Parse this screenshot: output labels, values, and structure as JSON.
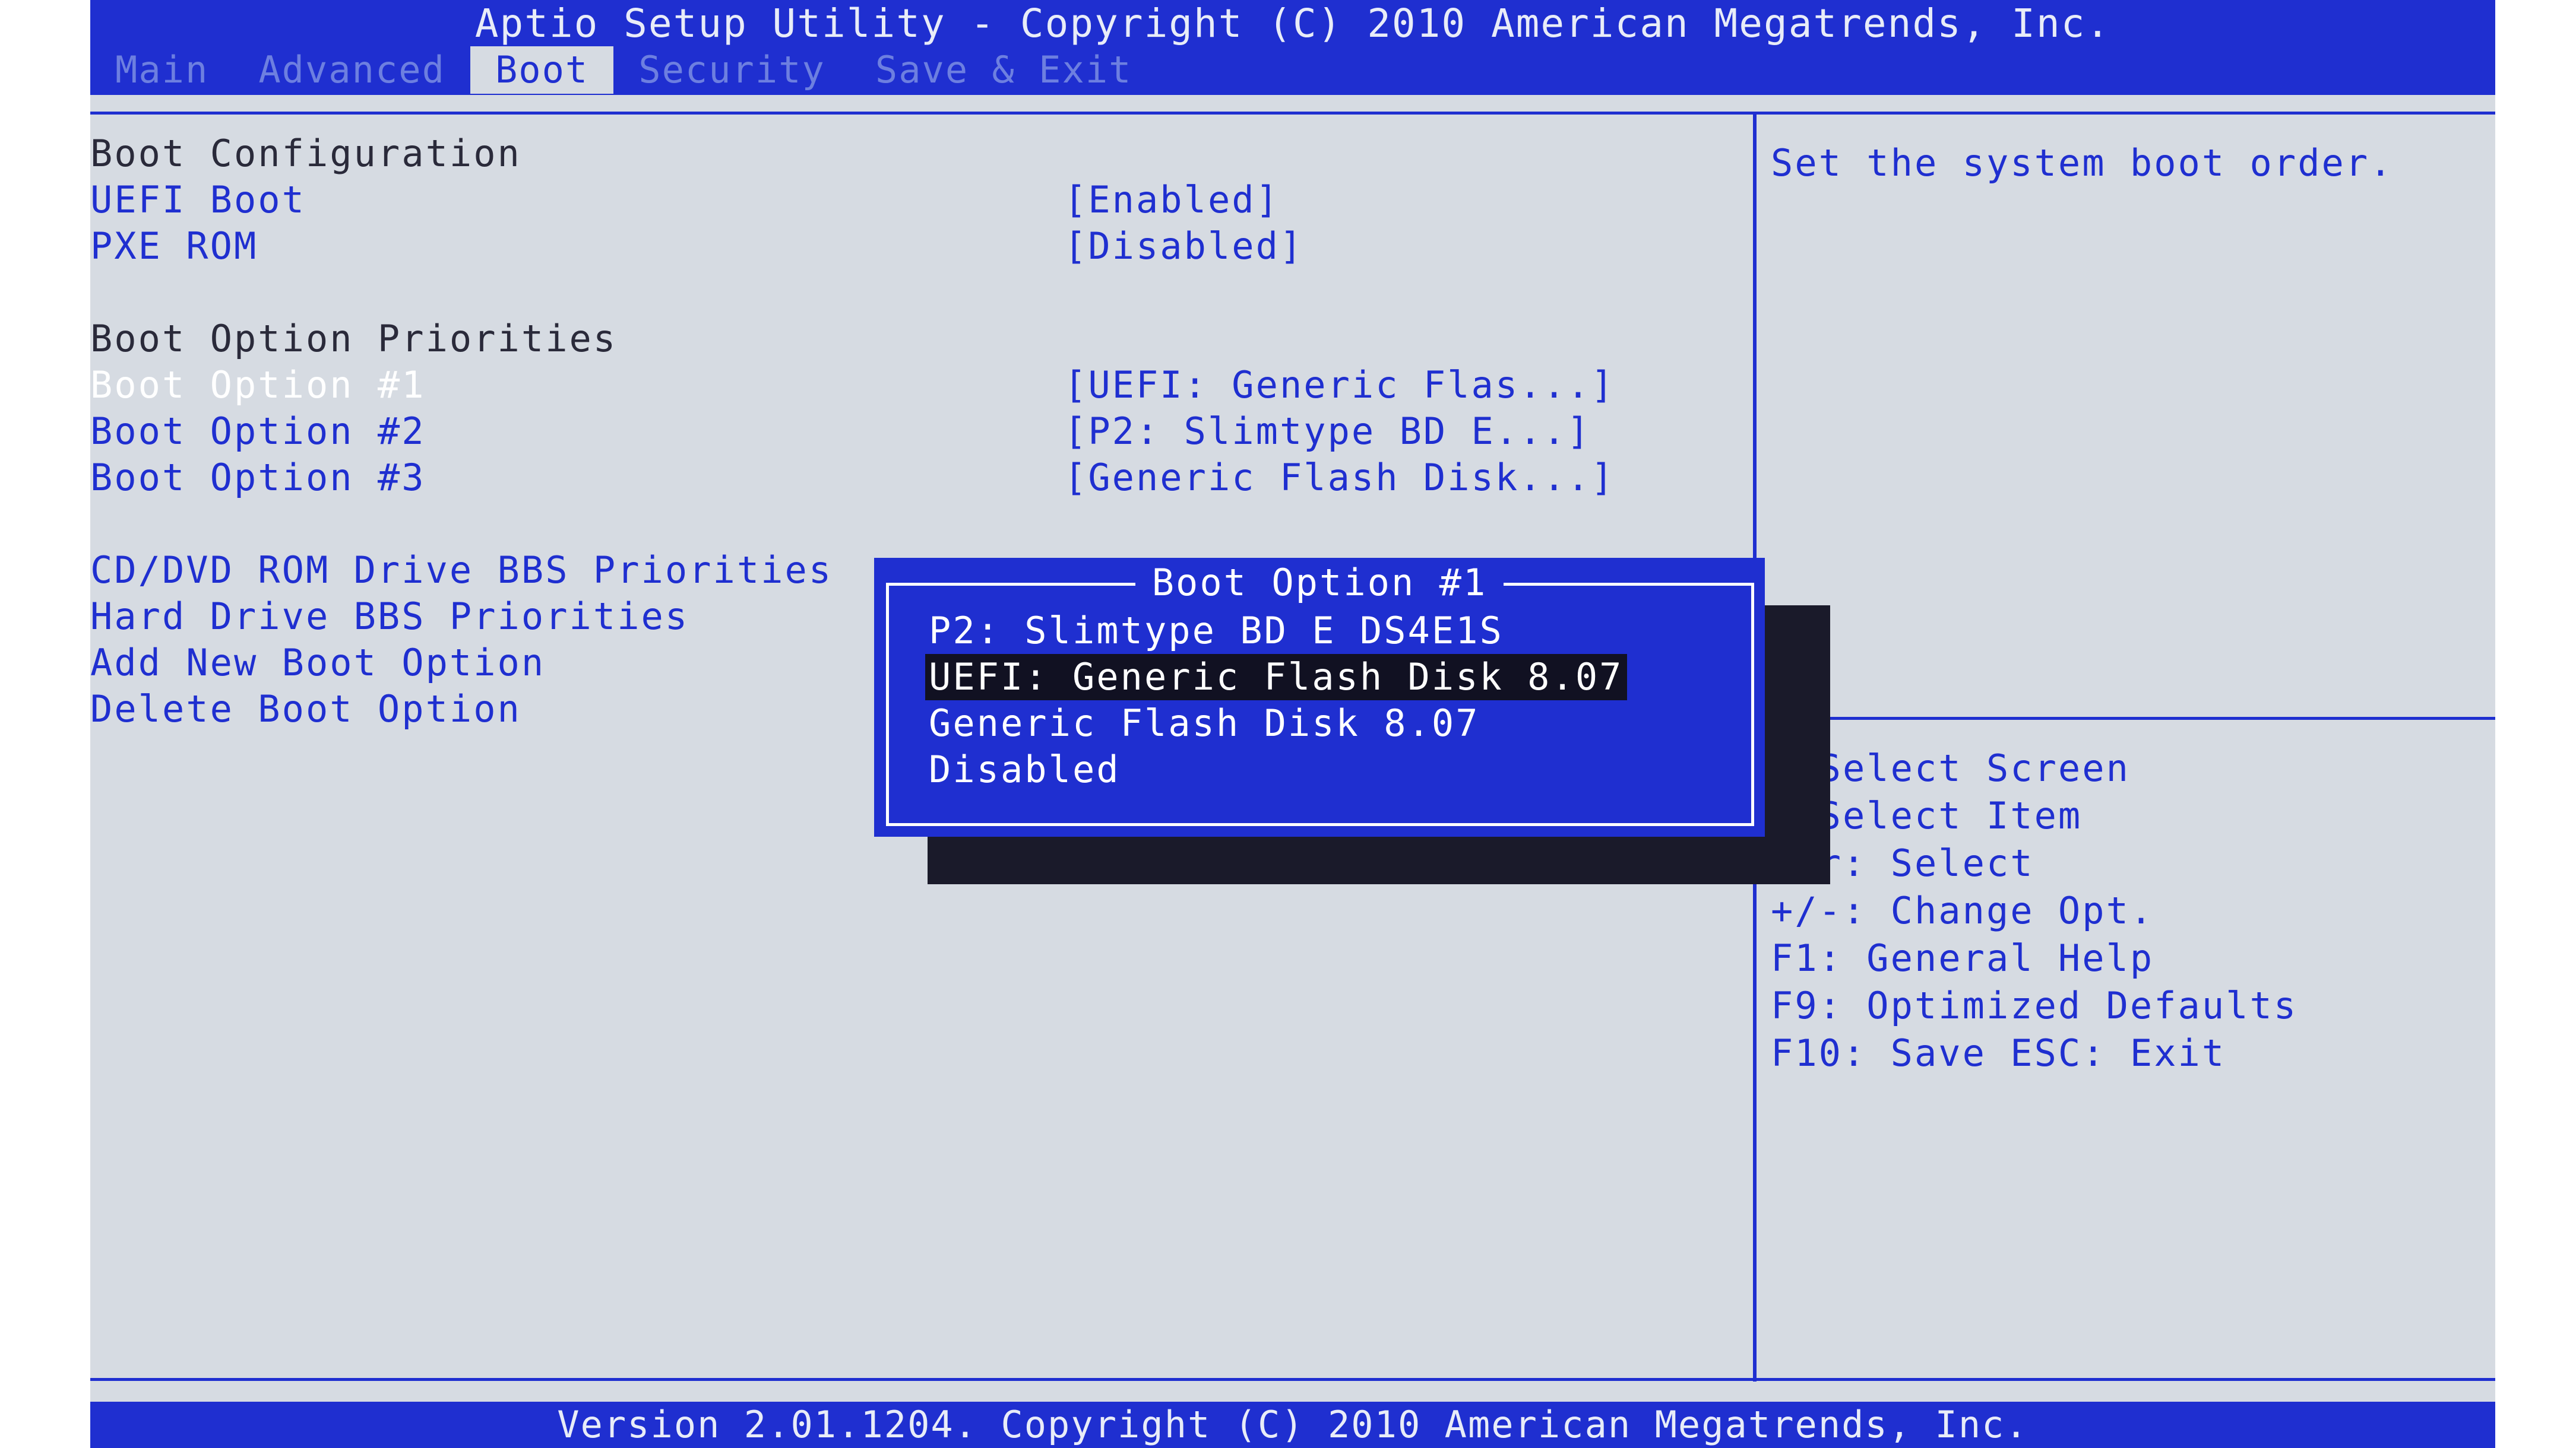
{
  "header": {
    "title": "Aptio Setup Utility - Copyright (C) 2010 American Megatrends, Inc.",
    "tabs": [
      {
        "label": "Main"
      },
      {
        "label": "Advanced"
      },
      {
        "label": "Boot"
      },
      {
        "label": "Security"
      },
      {
        "label": "Save & Exit"
      }
    ],
    "active_tab": "Boot"
  },
  "main": {
    "boot_configuration": "Boot Configuration",
    "uefi_boot": {
      "label": "UEFI Boot",
      "value": "[Enabled]"
    },
    "pxe_rom": {
      "label": "PXE ROM",
      "value": "[Disabled]"
    },
    "boot_option_priorities": "Boot Option Priorities",
    "boot_option_1": {
      "label": "Boot Option #1",
      "value": "[UEFI: Generic Flas...]"
    },
    "boot_option_2": {
      "label": "Boot Option #2",
      "value": "[P2: Slimtype BD  E...]"
    },
    "boot_option_3": {
      "label": "Boot Option #3",
      "value": "[Generic Flash Disk...]"
    },
    "cd_dvd": "CD/DVD ROM Drive BBS Priorities",
    "hdd": "Hard Drive BBS Priorities",
    "add_boot": "Add New Boot Option",
    "delete_boot": "Delete Boot Option"
  },
  "help": {
    "text": "Set the system boot order.",
    "keys": [
      ": Select Screen",
      ": Select Item",
      "ter: Select",
      "+/-: Change Opt.",
      "F1: General Help",
      "F9: Optimized Defaults",
      "F10: Save  ESC: Exit"
    ]
  },
  "popup": {
    "title": "Boot Option #1",
    "options": [
      "P2: Slimtype BD  E  DS4E1S",
      "UEFI: Generic Flash Disk 8.07",
      "Generic Flash Disk 8.07",
      "Disabled"
    ],
    "selected_index": 1
  },
  "footer": {
    "text": "Version 2.01.1204. Copyright (C) 2010 American Megatrends, Inc."
  },
  "colors": {
    "bios_blue": "#1f2fd0",
    "bios_gray": "#d6dbe2",
    "selection_dark": "#111122"
  }
}
